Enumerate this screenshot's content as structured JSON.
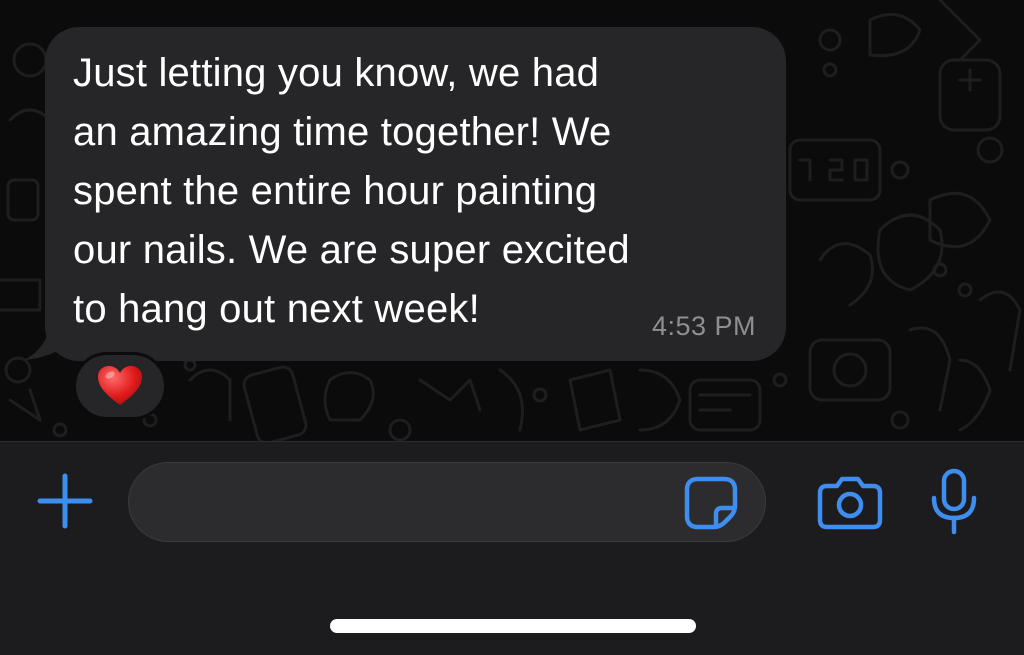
{
  "message": {
    "text": "Just letting you know, we had\nan amazing time together! We\nspent the entire hour painting\nour nails. We are super excited\nto hang out next week!",
    "time": "4:53 PM",
    "reaction": "❤️"
  },
  "composer": {
    "input_value": "",
    "placeholder": "",
    "plus_icon": "plus-icon",
    "sticker_icon": "sticker-icon",
    "camera_icon": "camera-icon",
    "mic_icon": "microphone-icon"
  },
  "colors": {
    "background": "#0b0b0b",
    "bubble": "#262628",
    "text": "#ffffff",
    "timestamp": "#8e8e93",
    "accent": "#3e8ef0",
    "input_bar": "#1c1c1e",
    "input_field": "#2c2c2e"
  }
}
